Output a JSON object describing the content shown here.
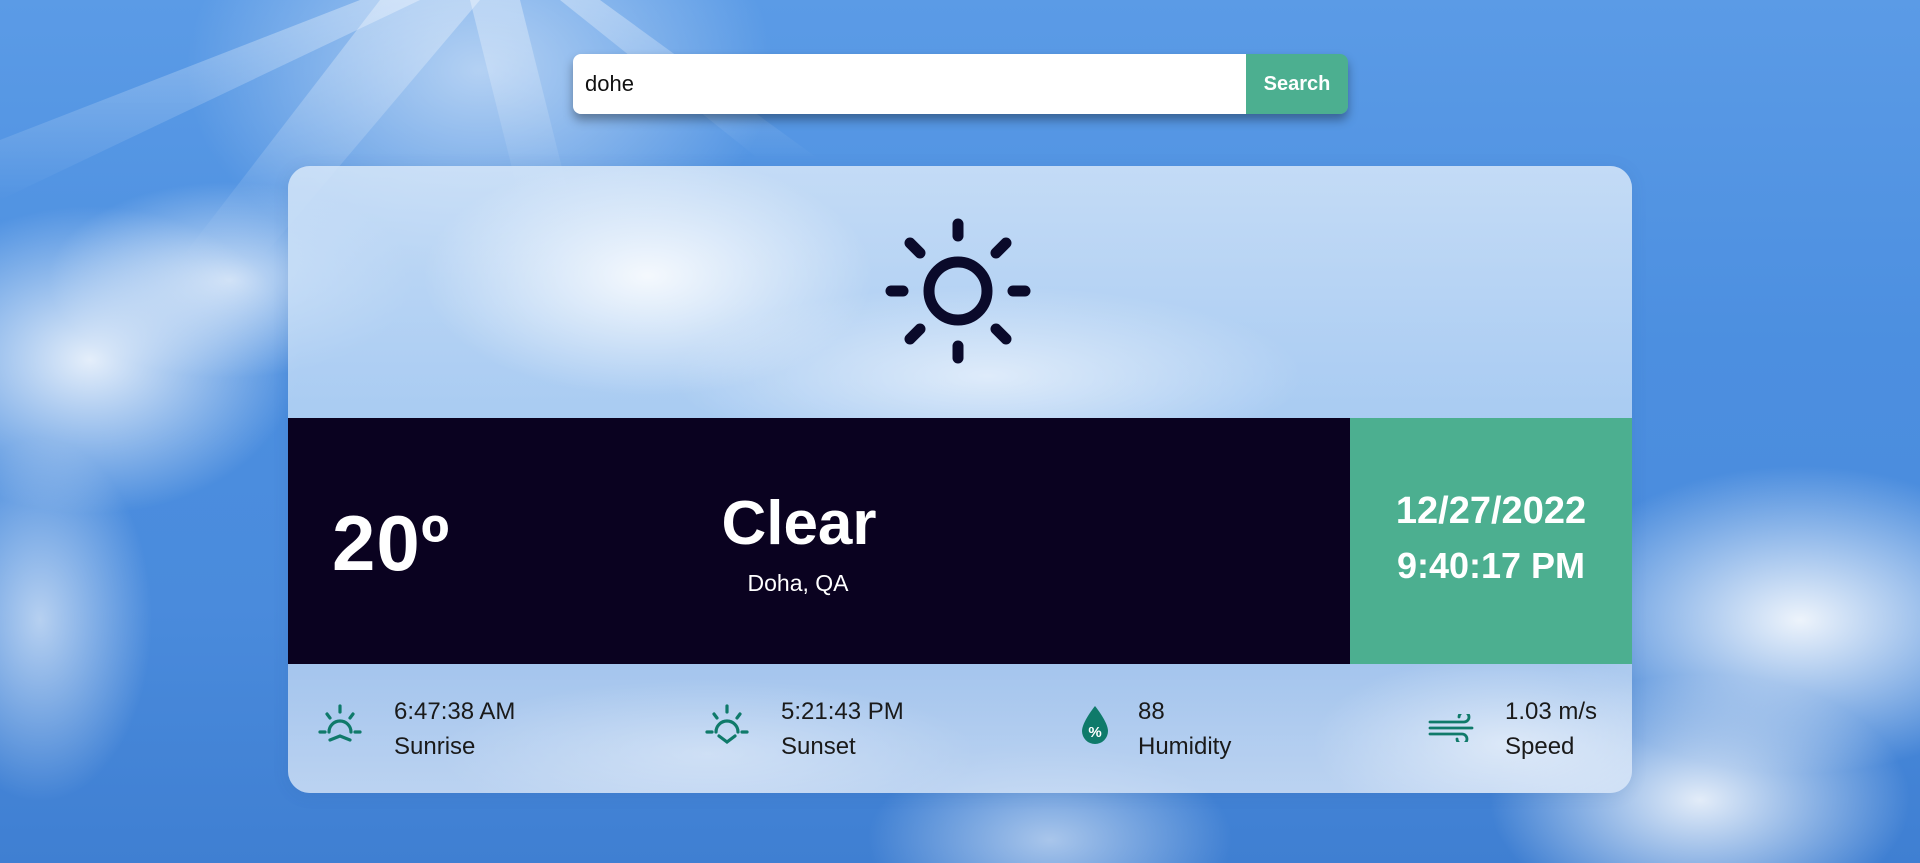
{
  "search": {
    "value": "dohe",
    "button_label": "Search"
  },
  "weather": {
    "icon": "sun-icon",
    "temperature": "20º",
    "condition": "Clear",
    "location": "Doha, QA",
    "date": "12/27/2022",
    "time": "9:40:17 PM"
  },
  "stats": {
    "sunrise": {
      "value": "6:47:38 AM",
      "label": "Sunrise",
      "icon": "sunrise-icon"
    },
    "sunset": {
      "value": "5:21:43 PM",
      "label": "Sunset",
      "icon": "sunset-icon"
    },
    "humidity": {
      "value": "88",
      "label": "Humidity",
      "icon": "humidity-icon"
    },
    "speed": {
      "value": "1.03 m/s",
      "label": "Speed",
      "icon": "wind-icon"
    }
  },
  "colors": {
    "accent": "#4caf90",
    "band": "#0a0220",
    "icon_teal": "#0f7a6a",
    "sun_icon": "#0a0a2a"
  }
}
